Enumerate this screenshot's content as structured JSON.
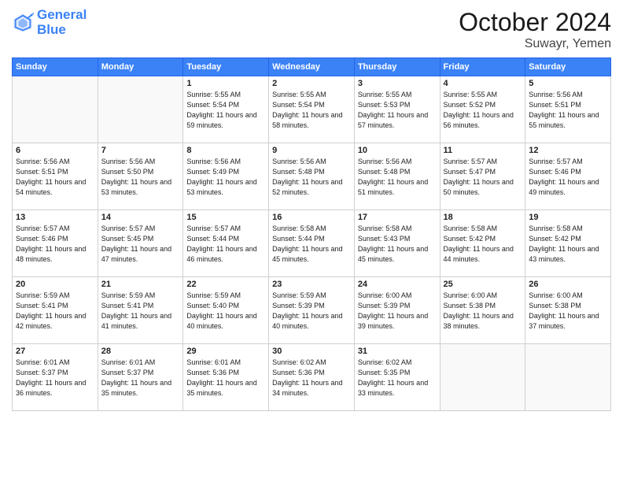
{
  "header": {
    "logo_line1": "General",
    "logo_line2": "Blue",
    "month": "October 2024",
    "location": "Suwayr, Yemen"
  },
  "weekdays": [
    "Sunday",
    "Monday",
    "Tuesday",
    "Wednesday",
    "Thursday",
    "Friday",
    "Saturday"
  ],
  "weeks": [
    [
      {
        "day": "",
        "sunrise": "",
        "sunset": "",
        "daylight": ""
      },
      {
        "day": "",
        "sunrise": "",
        "sunset": "",
        "daylight": ""
      },
      {
        "day": "1",
        "sunrise": "Sunrise: 5:55 AM",
        "sunset": "Sunset: 5:54 PM",
        "daylight": "Daylight: 11 hours and 59 minutes."
      },
      {
        "day": "2",
        "sunrise": "Sunrise: 5:55 AM",
        "sunset": "Sunset: 5:54 PM",
        "daylight": "Daylight: 11 hours and 58 minutes."
      },
      {
        "day": "3",
        "sunrise": "Sunrise: 5:55 AM",
        "sunset": "Sunset: 5:53 PM",
        "daylight": "Daylight: 11 hours and 57 minutes."
      },
      {
        "day": "4",
        "sunrise": "Sunrise: 5:55 AM",
        "sunset": "Sunset: 5:52 PM",
        "daylight": "Daylight: 11 hours and 56 minutes."
      },
      {
        "day": "5",
        "sunrise": "Sunrise: 5:56 AM",
        "sunset": "Sunset: 5:51 PM",
        "daylight": "Daylight: 11 hours and 55 minutes."
      }
    ],
    [
      {
        "day": "6",
        "sunrise": "Sunrise: 5:56 AM",
        "sunset": "Sunset: 5:51 PM",
        "daylight": "Daylight: 11 hours and 54 minutes."
      },
      {
        "day": "7",
        "sunrise": "Sunrise: 5:56 AM",
        "sunset": "Sunset: 5:50 PM",
        "daylight": "Daylight: 11 hours and 53 minutes."
      },
      {
        "day": "8",
        "sunrise": "Sunrise: 5:56 AM",
        "sunset": "Sunset: 5:49 PM",
        "daylight": "Daylight: 11 hours and 53 minutes."
      },
      {
        "day": "9",
        "sunrise": "Sunrise: 5:56 AM",
        "sunset": "Sunset: 5:48 PM",
        "daylight": "Daylight: 11 hours and 52 minutes."
      },
      {
        "day": "10",
        "sunrise": "Sunrise: 5:56 AM",
        "sunset": "Sunset: 5:48 PM",
        "daylight": "Daylight: 11 hours and 51 minutes."
      },
      {
        "day": "11",
        "sunrise": "Sunrise: 5:57 AM",
        "sunset": "Sunset: 5:47 PM",
        "daylight": "Daylight: 11 hours and 50 minutes."
      },
      {
        "day": "12",
        "sunrise": "Sunrise: 5:57 AM",
        "sunset": "Sunset: 5:46 PM",
        "daylight": "Daylight: 11 hours and 49 minutes."
      }
    ],
    [
      {
        "day": "13",
        "sunrise": "Sunrise: 5:57 AM",
        "sunset": "Sunset: 5:46 PM",
        "daylight": "Daylight: 11 hours and 48 minutes."
      },
      {
        "day": "14",
        "sunrise": "Sunrise: 5:57 AM",
        "sunset": "Sunset: 5:45 PM",
        "daylight": "Daylight: 11 hours and 47 minutes."
      },
      {
        "day": "15",
        "sunrise": "Sunrise: 5:57 AM",
        "sunset": "Sunset: 5:44 PM",
        "daylight": "Daylight: 11 hours and 46 minutes."
      },
      {
        "day": "16",
        "sunrise": "Sunrise: 5:58 AM",
        "sunset": "Sunset: 5:44 PM",
        "daylight": "Daylight: 11 hours and 45 minutes."
      },
      {
        "day": "17",
        "sunrise": "Sunrise: 5:58 AM",
        "sunset": "Sunset: 5:43 PM",
        "daylight": "Daylight: 11 hours and 45 minutes."
      },
      {
        "day": "18",
        "sunrise": "Sunrise: 5:58 AM",
        "sunset": "Sunset: 5:42 PM",
        "daylight": "Daylight: 11 hours and 44 minutes."
      },
      {
        "day": "19",
        "sunrise": "Sunrise: 5:58 AM",
        "sunset": "Sunset: 5:42 PM",
        "daylight": "Daylight: 11 hours and 43 minutes."
      }
    ],
    [
      {
        "day": "20",
        "sunrise": "Sunrise: 5:59 AM",
        "sunset": "Sunset: 5:41 PM",
        "daylight": "Daylight: 11 hours and 42 minutes."
      },
      {
        "day": "21",
        "sunrise": "Sunrise: 5:59 AM",
        "sunset": "Sunset: 5:41 PM",
        "daylight": "Daylight: 11 hours and 41 minutes."
      },
      {
        "day": "22",
        "sunrise": "Sunrise: 5:59 AM",
        "sunset": "Sunset: 5:40 PM",
        "daylight": "Daylight: 11 hours and 40 minutes."
      },
      {
        "day": "23",
        "sunrise": "Sunrise: 5:59 AM",
        "sunset": "Sunset: 5:39 PM",
        "daylight": "Daylight: 11 hours and 40 minutes."
      },
      {
        "day": "24",
        "sunrise": "Sunrise: 6:00 AM",
        "sunset": "Sunset: 5:39 PM",
        "daylight": "Daylight: 11 hours and 39 minutes."
      },
      {
        "day": "25",
        "sunrise": "Sunrise: 6:00 AM",
        "sunset": "Sunset: 5:38 PM",
        "daylight": "Daylight: 11 hours and 38 minutes."
      },
      {
        "day": "26",
        "sunrise": "Sunrise: 6:00 AM",
        "sunset": "Sunset: 5:38 PM",
        "daylight": "Daylight: 11 hours and 37 minutes."
      }
    ],
    [
      {
        "day": "27",
        "sunrise": "Sunrise: 6:01 AM",
        "sunset": "Sunset: 5:37 PM",
        "daylight": "Daylight: 11 hours and 36 minutes."
      },
      {
        "day": "28",
        "sunrise": "Sunrise: 6:01 AM",
        "sunset": "Sunset: 5:37 PM",
        "daylight": "Daylight: 11 hours and 35 minutes."
      },
      {
        "day": "29",
        "sunrise": "Sunrise: 6:01 AM",
        "sunset": "Sunset: 5:36 PM",
        "daylight": "Daylight: 11 hours and 35 minutes."
      },
      {
        "day": "30",
        "sunrise": "Sunrise: 6:02 AM",
        "sunset": "Sunset: 5:36 PM",
        "daylight": "Daylight: 11 hours and 34 minutes."
      },
      {
        "day": "31",
        "sunrise": "Sunrise: 6:02 AM",
        "sunset": "Sunset: 5:35 PM",
        "daylight": "Daylight: 11 hours and 33 minutes."
      },
      {
        "day": "",
        "sunrise": "",
        "sunset": "",
        "daylight": ""
      },
      {
        "day": "",
        "sunrise": "",
        "sunset": "",
        "daylight": ""
      }
    ]
  ]
}
